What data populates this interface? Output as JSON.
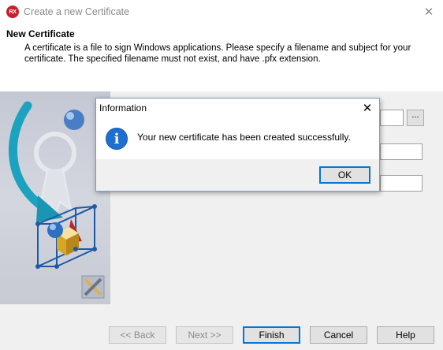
{
  "window": {
    "app_icon_text": "RX",
    "title": "Create a new Certificate",
    "close_glyph": "✕"
  },
  "header": {
    "title": "New Certificate",
    "description": "A certificate is a file to sign Windows applications. Please specify a filename and subject for your certificate. The specified filename must not exist, and have .pfx extension."
  },
  "form": {
    "browse_label": "...",
    "fields": [
      "",
      "",
      ""
    ]
  },
  "buttons": {
    "back": "<< Back",
    "next": "Next >>",
    "finish": "Finish",
    "cancel": "Cancel",
    "help": "Help"
  },
  "dialog": {
    "title": "Information",
    "close_glyph": "✕",
    "icon": "info-icon",
    "icon_glyph": "i",
    "message": "Your new certificate has been created successfully.",
    "ok_label": "OK"
  },
  "colors": {
    "accent": "#0078d7",
    "app_icon": "#c8202a",
    "info_icon": "#1e6fd0"
  }
}
